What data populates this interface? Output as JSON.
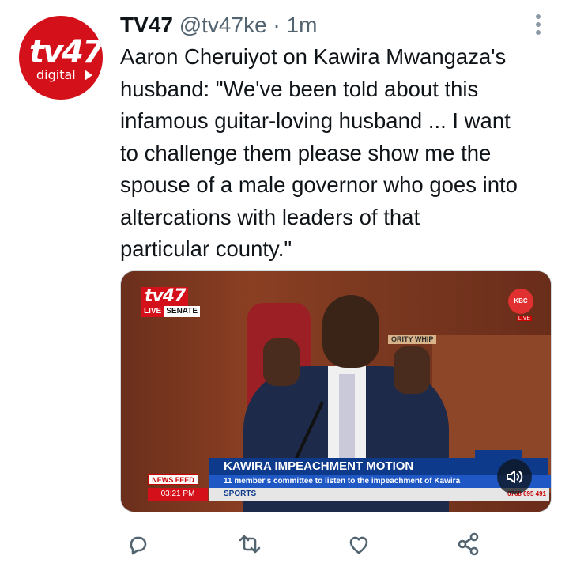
{
  "author": {
    "name": "TV47",
    "handle": "@tv47ke",
    "separator": "·",
    "time": "1m",
    "avatar_text": "tv47",
    "avatar_subtext": "digital"
  },
  "tweet": {
    "text": "Aaron Cheruiyot on Kawira Mwangaza's\nhusband: \"We've been told about this\ninfamous guitar-loving husband ... I want\nto challenge them please show me the\nspouse of a male governor who goes into\naltercations with leaders of that\nparticular county.\""
  },
  "media": {
    "channel_logo": "tv47",
    "live_label": "LIVE",
    "senate_label": "SENATE",
    "kbc_label": "KBC",
    "kbc_live": "LIVE",
    "placard_text": "ORITY WHIP",
    "headline": "KAWIRA IMPEACHMENT MOTION",
    "subheadline": "11 member's committee to listen to the impeachment of Kawira",
    "ticker_label": "SPORTS",
    "phone": "0768 095 491",
    "newsfeed_label": "NEWS FEED",
    "clock": "03:21 PM"
  },
  "icons": {
    "more": "more-vertical-icon",
    "reply": "reply-icon",
    "retweet": "retweet-icon",
    "like": "like-icon",
    "share": "share-icon",
    "sound": "sound-icon"
  }
}
